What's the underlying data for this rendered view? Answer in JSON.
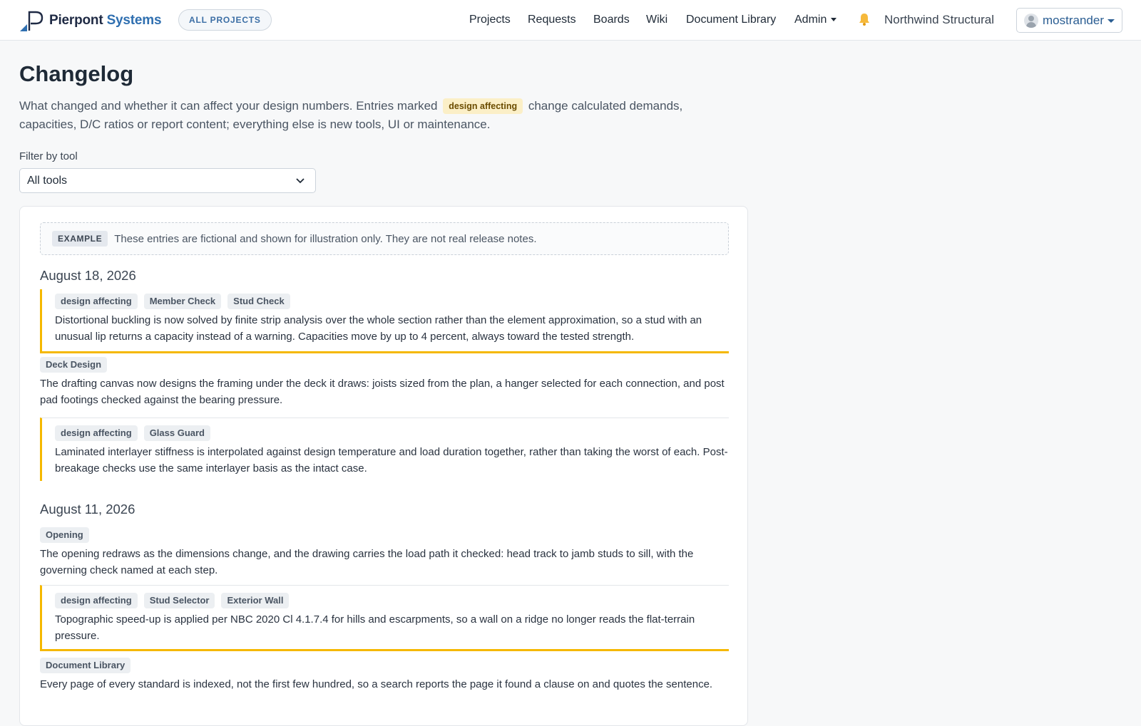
{
  "brand": {
    "name_part1": "Pierpont",
    "name_part2": "Systems"
  },
  "header": {
    "all_projects_label": "ALL PROJECTS",
    "nav": [
      "Projects",
      "Requests",
      "Boards",
      "Wiki",
      "Document Library",
      "Admin"
    ],
    "org_name": "Northwind Structural",
    "user_name": "mostrander"
  },
  "page": {
    "title": "Changelog",
    "intro_before": "What changed and whether it can affect your design numbers. Entries marked",
    "intro_badge": "design affecting",
    "intro_after": "change calculated demands, capacities, D/C ratios or report content; everything else is new tools, UI or maintenance.",
    "filter_label": "Filter by tool",
    "filter_value": "All tools"
  },
  "example": {
    "tag": "EXAMPLE",
    "text": "These entries are fictional and shown for illustration only. They are not real release notes."
  },
  "groups": [
    {
      "date": "August 18, 2026",
      "entries": [
        {
          "design": "design affecting",
          "tags": [
            "Member Check",
            "Stud Check"
          ],
          "text": "Distortional buckling is now solved by finite strip analysis over the whole section rather than the element approximation, so a stud with an unusual lip returns a capacity instead of a warning. Capacities move by up to 4 percent, always toward the tested strength."
        },
        {
          "design": "",
          "tags": [
            "Deck Design"
          ],
          "text": "The drafting canvas now designs the framing under the deck it draws: joists sized from the plan, a hanger selected for each connection, and post pad footings checked against the bearing pressure."
        },
        {
          "design": "design affecting",
          "tags": [
            "Glass Guard"
          ],
          "text": "Laminated interlayer stiffness is interpolated against design temperature and load duration together, rather than taking the worst of each. Post-breakage checks use the same interlayer basis as the intact case."
        }
      ]
    },
    {
      "date": "August 11, 2026",
      "entries": [
        {
          "design": "",
          "tags": [
            "Opening"
          ],
          "text": "The opening redraws as the dimensions change, and the drawing carries the load path it checked: head track to jamb studs to sill, with the governing check named at each step."
        },
        {
          "design": "design affecting",
          "tags": [
            "Stud Selector",
            "Exterior Wall"
          ],
          "text": "Topographic speed-up is applied per NBC 2020 Cl 4.1.7.4 for hills and escarpments, so a wall on a ridge no longer reads the flat-terrain pressure."
        },
        {
          "design": "",
          "tags": [
            "Document Library"
          ],
          "text": "Every page of every standard is indexed, not the first few hundred, so a search reports the page it found a clause on and quotes the sentence."
        }
      ]
    }
  ],
  "colors": {
    "accent": "#f5b800",
    "brand_blue": "#2f6fb0",
    "badge_bg": "#fbefc7"
  }
}
